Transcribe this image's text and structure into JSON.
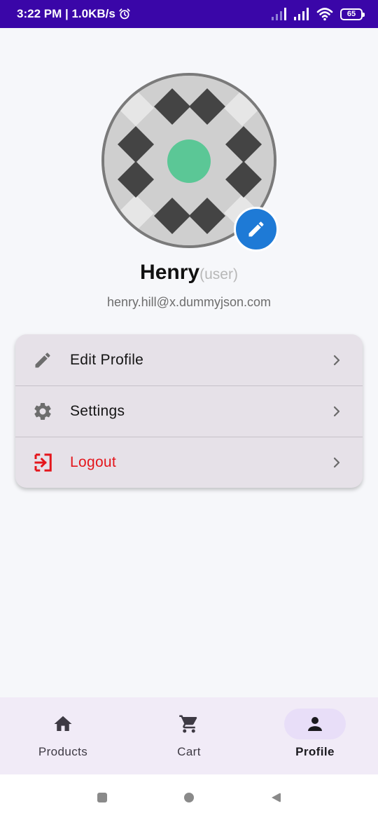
{
  "status_bar": {
    "time_speed": "3:22 PM | 1.0KB/s",
    "battery": "65",
    "icons": [
      "alarm-icon",
      "signal-icon",
      "signal-icon",
      "wifi-icon",
      "battery-icon"
    ]
  },
  "profile": {
    "name": "Henry",
    "role": "(user)",
    "email": "henry.hill@x.dummyjson.com",
    "avatar_colors": {
      "dark": "#444444",
      "light": "#e6e6e6",
      "center": "#5bc796"
    },
    "edit_icon": "pencil-icon"
  },
  "menu": {
    "items": [
      {
        "label": "Edit Profile",
        "icon": "pencil-icon"
      },
      {
        "label": "Settings",
        "icon": "gear-icon"
      },
      {
        "label": "Logout",
        "icon": "logout-icon",
        "color": "#e4161c"
      }
    ]
  },
  "bottom_nav": {
    "items": [
      {
        "label": "Products",
        "icon": "home-icon",
        "active": false
      },
      {
        "label": "Cart",
        "icon": "cart-icon",
        "active": false
      },
      {
        "label": "Profile",
        "icon": "person-icon",
        "active": true
      }
    ]
  },
  "colors": {
    "status_bar": "#3a06a8",
    "accent": "#1e7ad6",
    "danger": "#e4161c",
    "nav_active_pill": "#e8def8"
  }
}
